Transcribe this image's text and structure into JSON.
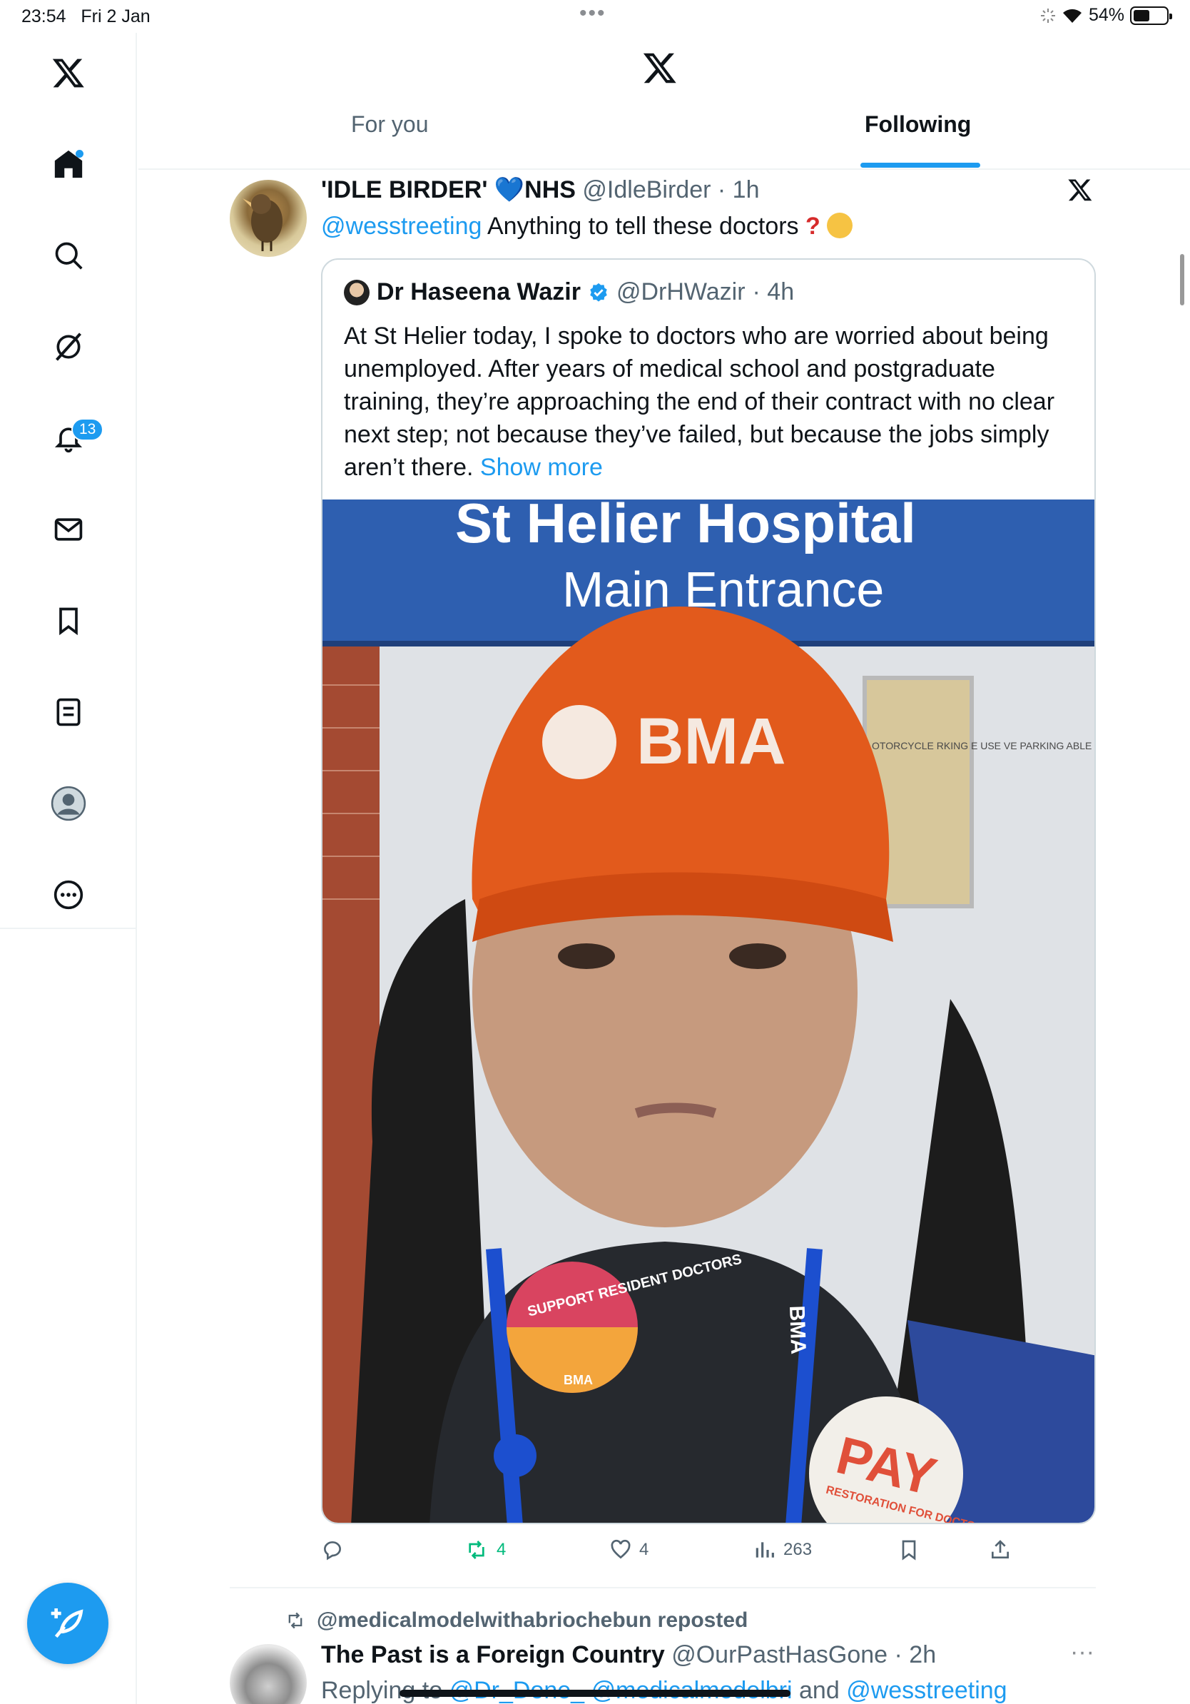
{
  "status_bar": {
    "time": "23:54",
    "date": "Fri 2 Jan",
    "battery": "54%",
    "battery_level": 0.54
  },
  "sidebar": {
    "notification_count": "13"
  },
  "tabs": {
    "for_you": "For you",
    "following": "Following",
    "active": "following"
  },
  "tweet1": {
    "name": "'IDLE BIRDER' 💙NHS",
    "handle": "@IdleBirder",
    "time": "· 1h",
    "mention": "@wesstreeting",
    "text": "Anything to tell these doctors",
    "quote": {
      "name": "Dr Haseena Wazir",
      "handle": "@DrHWazir",
      "time": "· 4h",
      "text": "At St Helier today, I spoke to doctors who are worried about being unemployed. After years of medical school and postgraduate training, they’re approaching the end of their contract with no clear next step; not because they’ve failed, but because the jobs simply aren’t there. ",
      "show_more": "Show more",
      "photo": {
        "sign_line1": "St Helier Hospital",
        "sign_line2": "Main Entrance",
        "hat_text": "BMA",
        "badge1_text": "SUPPORT RESIDENT DOCTORS",
        "badge1_footer": "BMA",
        "badge2_title": "PAY",
        "badge2_sub": "RESTORATION FOR DOCTORS",
        "lanyard_text": "BMA",
        "plaque_text": "OTORCYCLE RKING E USE VE PARKING ABLE IN CLE POD CAN BE THE STAFF PARK"
      }
    },
    "stats": {
      "reposts": "4",
      "likes": "4",
      "views": "263"
    }
  },
  "tweet2": {
    "repost_label": "@medicalmodelwithabriochebun reposted",
    "name": "The Past is a Foreign Country",
    "handle": "@OurPastHasGone",
    "time": "· 2h",
    "replying_prefix": "Replying to",
    "replying_to": "@Dr_Done_ @medicalmodelbri",
    "replying_and": "and",
    "replying_last": "@wesstreeting"
  },
  "colors": {
    "accent": "#1d9bf0",
    "repost_green": "#00ba7c",
    "text_secondary": "#536471"
  }
}
